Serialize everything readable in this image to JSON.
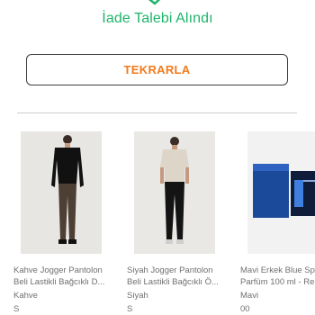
{
  "status": {
    "title": "İade Talebi Alındı",
    "icon": "check-icon",
    "color": "#1db56a"
  },
  "repeat_button": {
    "label": "TEKRARLA",
    "color": "#f27a1a"
  },
  "products": [
    {
      "name_line1": "Kahve Jogger Pantolon",
      "name_line2": "Beli Lastikli Bağcıklı D...",
      "color": "Kahve",
      "size": "S",
      "image": "man-in-black-shirt-brown-jogger-image"
    },
    {
      "name_line1": "Siyah Jogger Pantolon",
      "name_line2": "Beli Lastikli Bağcıklı Ö...",
      "color": "Siyah",
      "size": "S",
      "image": "man-in-beige-tshirt-black-jogger-image"
    },
    {
      "name_line1": "Mavi Erkek Blue Sp",
      "name_line2": "Parfüm 100 ml - Re",
      "color": "Mavi",
      "size": "00",
      "image": "blue-perfume-bottle-and-box-image"
    }
  ]
}
